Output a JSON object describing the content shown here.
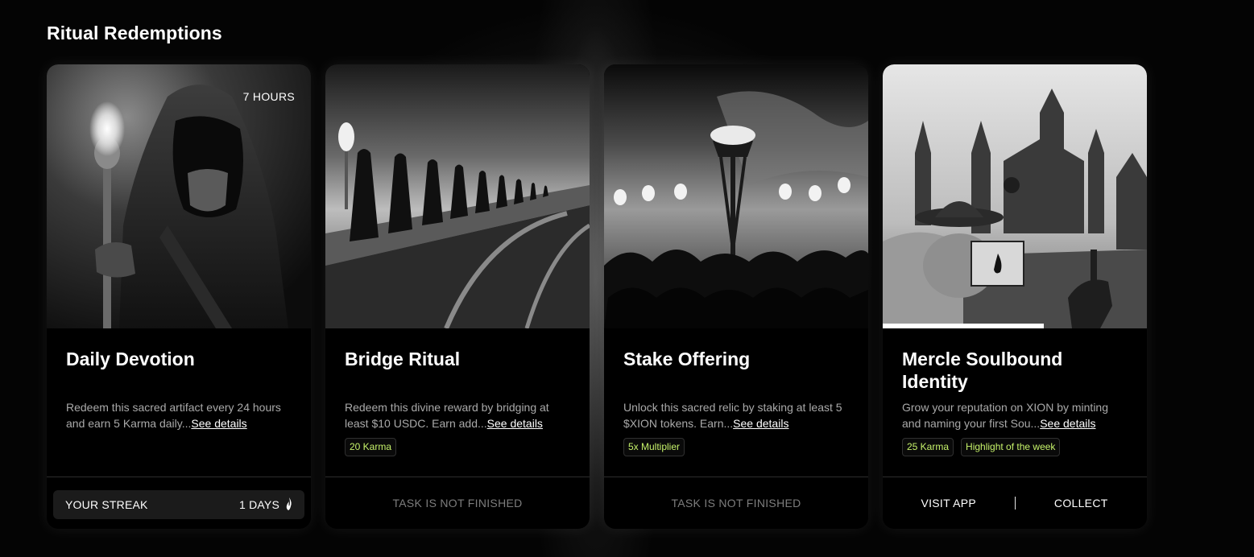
{
  "section": {
    "title": "Ritual Redemptions"
  },
  "colors": {
    "tag_text": "#c6f26a",
    "muted": "#a9a9a9",
    "status": "#7d7d7d"
  },
  "cards": [
    {
      "image_icon": "hooded-figure-torch-image",
      "timer": "7 HOURS",
      "title": "Daily Devotion",
      "description": "Redeem this sacred artifact every 24 hours and earn 5 Karma daily...",
      "see_details": "See details",
      "streak_label": "YOUR STREAK",
      "streak_value": "1 DAYS",
      "streak_icon": "flame-icon"
    },
    {
      "image_icon": "procession-bridge-image",
      "title": "Bridge Ritual",
      "description": "Redeem this divine reward by bridging at least $10 USDC. Earn add...",
      "see_details": "See details",
      "tags": [
        "20 Karma"
      ],
      "status": "TASK IS NOT FINISHED"
    },
    {
      "image_icon": "torch-crowd-image",
      "title": "Stake Offering",
      "description": "Unlock this sacred relic by staking at least 5 $XION tokens. Earn...",
      "see_details": "See details",
      "tags": [
        "5x Multiplier"
      ],
      "status": "TASK IS NOT FINISHED"
    },
    {
      "image_icon": "castle-frog-image",
      "title": "Mercle Soulbound Identity",
      "description": "Grow your reputation on XION by minting and naming your first Sou...",
      "see_details": "See details",
      "tags": [
        "25 Karma",
        "Highlight of the week"
      ],
      "visit_label": "VISIT APP",
      "collect_label": "COLLECT"
    }
  ]
}
